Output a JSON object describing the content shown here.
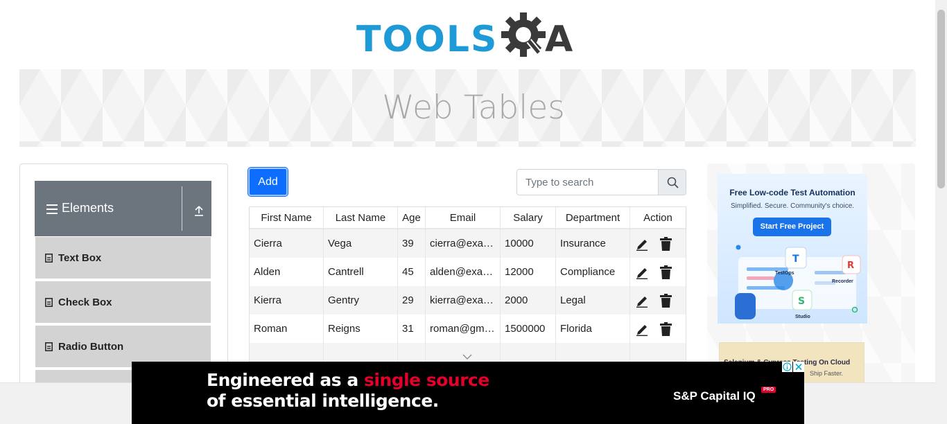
{
  "logo": {
    "text": "TOOLS",
    "suffix": "A"
  },
  "banner": {
    "title": "Web Tables"
  },
  "sidebar": {
    "group_title": "Elements",
    "items": [
      {
        "label": "Text Box"
      },
      {
        "label": "Check Box"
      },
      {
        "label": "Radio Button"
      }
    ]
  },
  "toolbar": {
    "add_label": "Add",
    "search_placeholder": "Type to search",
    "search_value": ""
  },
  "table": {
    "headers": [
      "First Name",
      "Last Name",
      "Age",
      "Email",
      "Salary",
      "Department",
      "Action"
    ],
    "rows": [
      [
        "Cierra",
        "Vega",
        "39",
        "cierra@example.com",
        "10000",
        "Insurance"
      ],
      [
        "Alden",
        "Cantrell",
        "45",
        "alden@example.com",
        "12000",
        "Compliance"
      ],
      [
        "Kierra",
        "Gentry",
        "29",
        "kierra@example.com",
        "2000",
        "Legal"
      ],
      [
        "Roman",
        "Reigns",
        "31",
        "roman@gmail.com",
        "1500000",
        "Florida"
      ]
    ]
  },
  "side_ad": {
    "title": "Free Low-code Test Automation",
    "subtitle": "Simplified. Secure. Community's choice.",
    "button": "Start Free Project",
    "labels": [
      "TestOps",
      "Recorder",
      "Studio"
    ],
    "ad2_text": "Selenium & Cypress Testing On Cloud",
    "ad2_sub": "Ship Faster."
  },
  "bottom_ad": {
    "line1_prefix": "Engineered as a ",
    "line1_highlight": "single source",
    "line2": "of essential intelligence.",
    "brand": "S&P Capital IQ",
    "badge": "PRO"
  },
  "colors": {
    "accent": "#0d6efd",
    "logo_blue": "#1e9ad6",
    "sidebar_header": "#6c757d",
    "sidebar_item": "#d3d3d3",
    "ad_highlight": "#e4002b"
  }
}
